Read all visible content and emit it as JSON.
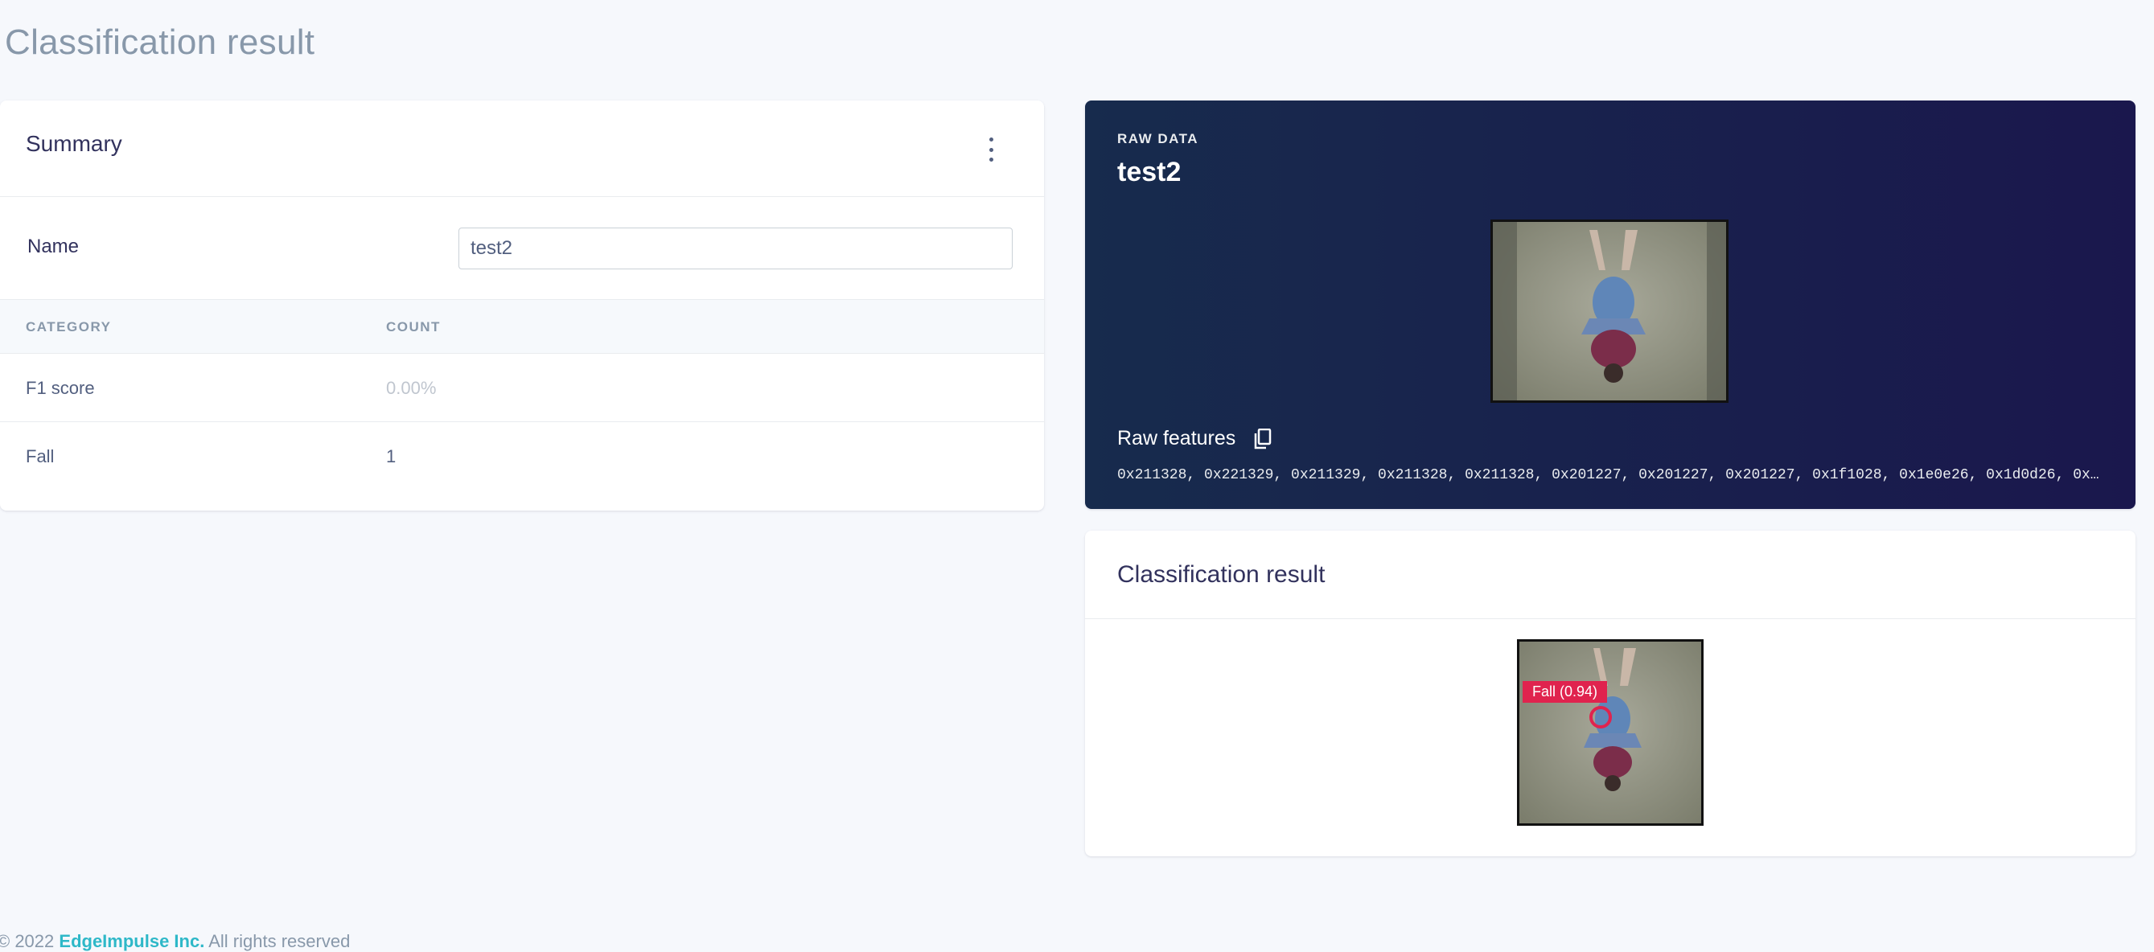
{
  "page": {
    "title": "Classification result"
  },
  "summary": {
    "title": "Summary",
    "name_label": "Name",
    "name_value": "test2",
    "columns": [
      "CATEGORY",
      "COUNT"
    ],
    "rows": [
      {
        "category": "F1 score",
        "count": "0.00%"
      },
      {
        "category": "Fall",
        "count": "1"
      }
    ]
  },
  "raw_data": {
    "eyebrow": "RAW DATA",
    "title": "test2",
    "features_label": "Raw features",
    "features_values": "0x211328, 0x221329, 0x211329, 0x211328, 0x211328, 0x201227, 0x201227, 0x201227, 0x1f1028, 0x1e0e26, 0x1d0d26, 0x1…"
  },
  "classification": {
    "title": "Classification result",
    "bbox_label": "Fall (0.94)",
    "bbox_color": "#e0234e"
  },
  "footer": {
    "prefix": "© 2022",
    "company": "EdgeImpulse Inc.",
    "suffix": "All rights reserved"
  },
  "icons": {
    "menu": "kebab-menu-icon",
    "copy": "copy-icon"
  }
}
